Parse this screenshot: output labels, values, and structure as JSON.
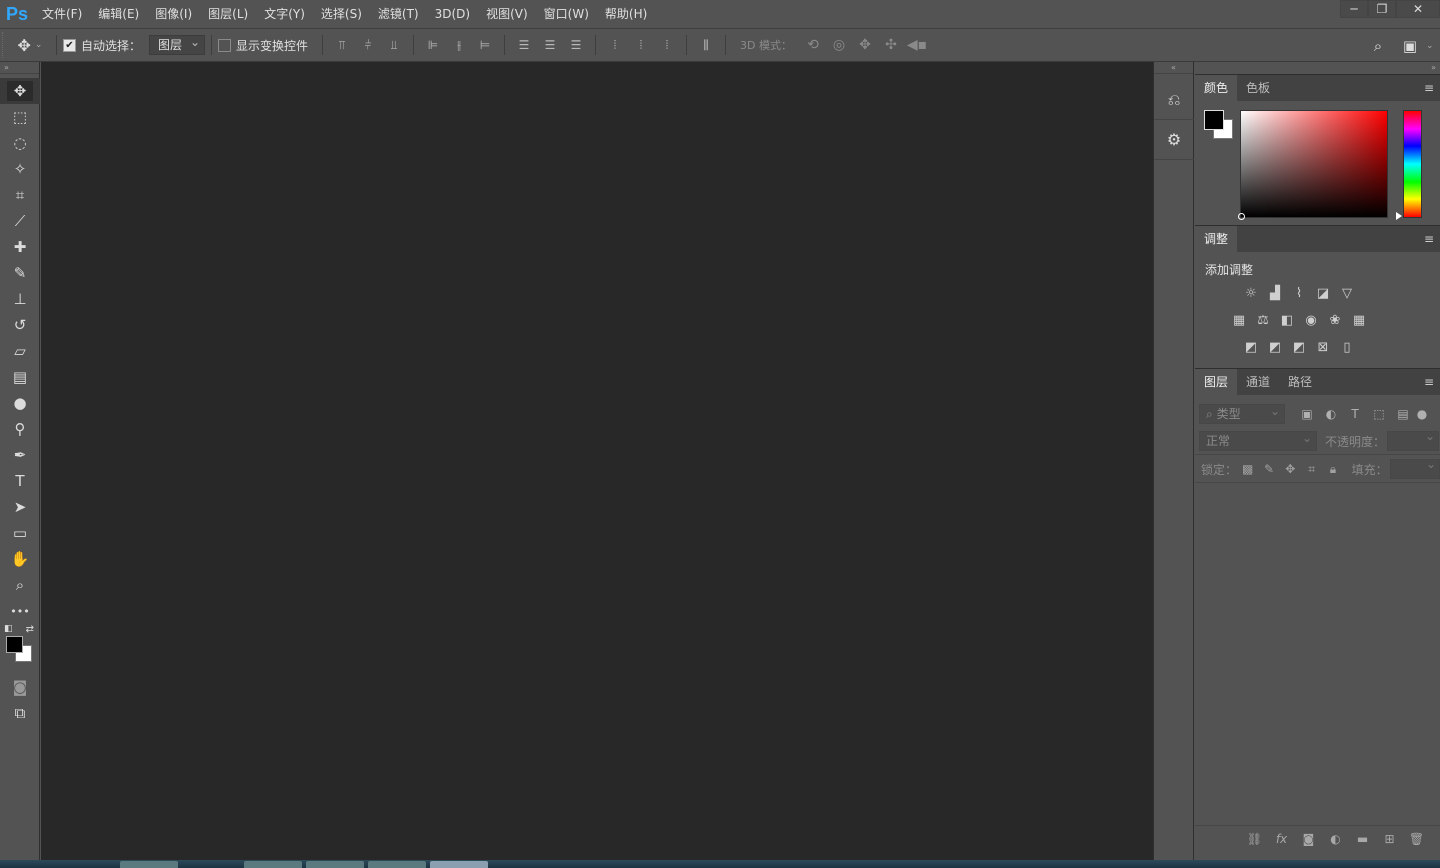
{
  "app": {
    "logo": "Ps"
  },
  "menu": [
    "文件(F)",
    "编辑(E)",
    "图像(I)",
    "图层(L)",
    "文字(Y)",
    "选择(S)",
    "滤镜(T)",
    "3D(D)",
    "视图(V)",
    "窗口(W)",
    "帮助(H)"
  ],
  "window": {
    "minimize": "─",
    "restore": "❐",
    "close": "✕"
  },
  "options": {
    "auto_select_label": "自动选择：",
    "auto_select_checked": true,
    "auto_select_value": "图层",
    "show_transform_label": "显示变换控件",
    "show_transform_checked": false,
    "mode3d_label": "3D 模式："
  },
  "toolbar": {
    "tools": [
      {
        "name": "move-tool",
        "glyph": "✥",
        "active": true
      },
      {
        "name": "marquee-tool",
        "glyph": "⬚"
      },
      {
        "name": "lasso-tool",
        "glyph": "◌"
      },
      {
        "name": "magic-wand-tool",
        "glyph": "✧"
      },
      {
        "name": "crop-tool",
        "glyph": "⌗"
      },
      {
        "name": "eyedropper-tool",
        "glyph": "⟋"
      },
      {
        "name": "healing-brush-tool",
        "glyph": "✚"
      },
      {
        "name": "brush-tool",
        "glyph": "✎"
      },
      {
        "name": "stamp-tool",
        "glyph": "⊥"
      },
      {
        "name": "history-brush-tool",
        "glyph": "↺"
      },
      {
        "name": "eraser-tool",
        "glyph": "▱"
      },
      {
        "name": "gradient-tool",
        "glyph": "▤"
      },
      {
        "name": "blur-tool",
        "glyph": "●"
      },
      {
        "name": "dodge-tool",
        "glyph": "⚲"
      },
      {
        "name": "pen-tool",
        "glyph": "✒"
      },
      {
        "name": "type-tool",
        "glyph": "T"
      },
      {
        "name": "path-selection-tool",
        "glyph": "➤"
      },
      {
        "name": "rectangle-tool",
        "glyph": "▭"
      },
      {
        "name": "hand-tool",
        "glyph": "✋"
      },
      {
        "name": "zoom-tool",
        "glyph": "⌕"
      },
      {
        "name": "more-tools",
        "glyph": "•••"
      }
    ],
    "quickmask_glyph": "◙",
    "screenmode_glyph": "⧉"
  },
  "panels": {
    "color_tabs": [
      "颜色",
      "色板"
    ],
    "adjust_tab": "调整",
    "adjust_title": "添加调整",
    "layers_tabs": [
      "图层",
      "通道",
      "路径"
    ],
    "layers_filter": "类型",
    "blend_mode": "正常",
    "opacity_label": "不透明度：",
    "lock_label": "锁定：",
    "fill_label": "填充："
  },
  "colors": {
    "foreground": "#000000",
    "background": "#ffffff",
    "accent": "#31a8ff"
  }
}
